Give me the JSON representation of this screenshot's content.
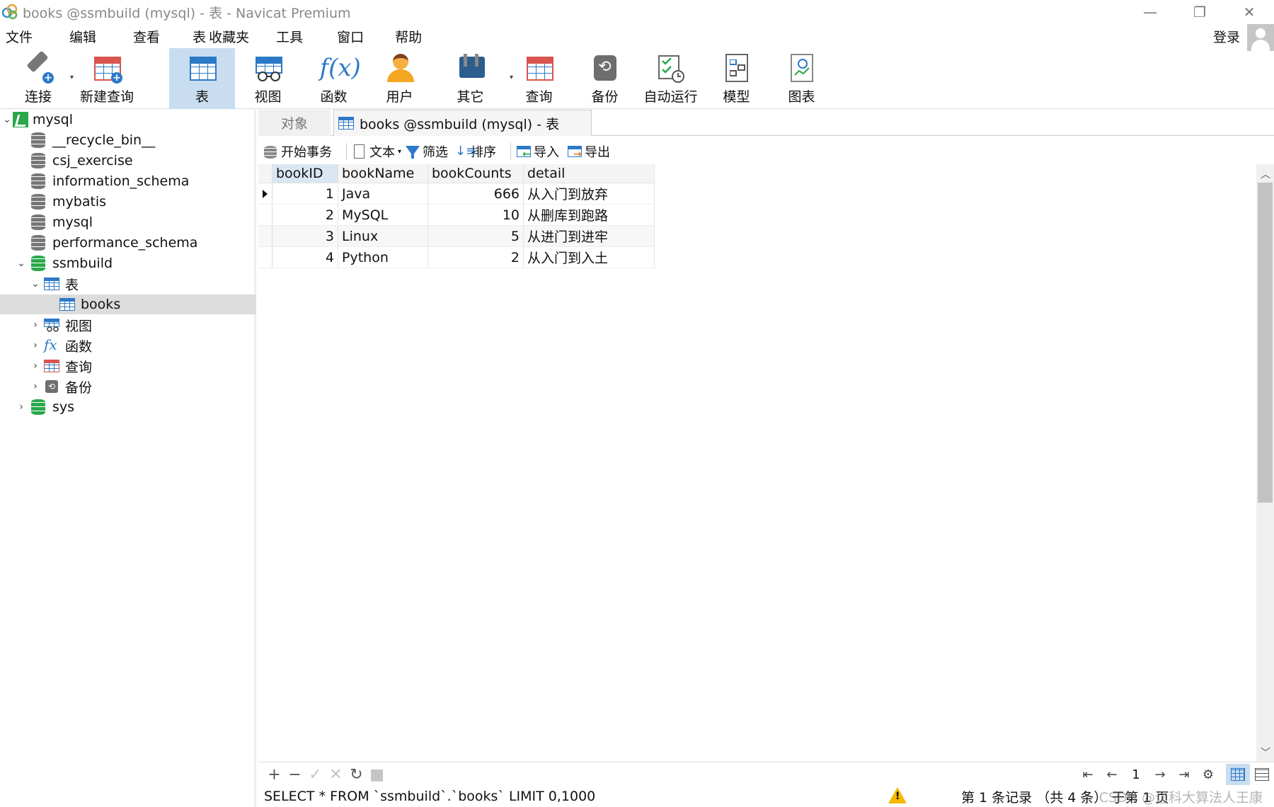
{
  "window": {
    "title": "books @ssmbuild (mysql) - 表 - Navicat Premium",
    "controls": [
      "—",
      "❐",
      "✕"
    ]
  },
  "menu": {
    "items": [
      "文件",
      "编辑",
      "查看",
      "表",
      "收藏夹",
      "工具",
      "窗口",
      "帮助"
    ],
    "login": "登录"
  },
  "toolbar": {
    "buttons": [
      {
        "label": "连接",
        "icon": "connection-icon"
      },
      {
        "label": "新建查询",
        "icon": "new-query-icon"
      },
      {
        "label": "表",
        "icon": "table-icon",
        "active": true
      },
      {
        "label": "视图",
        "icon": "view-icon"
      },
      {
        "label": "函数",
        "icon": "function-icon"
      },
      {
        "label": "用户",
        "icon": "user-icon"
      },
      {
        "label": "其它",
        "icon": "tools-icon"
      },
      {
        "label": "查询",
        "icon": "query-icon"
      },
      {
        "label": "备份",
        "icon": "backup-icon"
      },
      {
        "label": "自动运行",
        "icon": "automation-icon"
      },
      {
        "label": "模型",
        "icon": "model-icon"
      },
      {
        "label": "图表",
        "icon": "chart-icon"
      }
    ]
  },
  "tree": {
    "connection": "mysql",
    "databases": [
      "__recycle_bin__",
      "csj_exercise",
      "information_schema",
      "mybatis",
      "mysql",
      "performance_schema",
      "ssmbuild",
      "sys"
    ],
    "ssmbuild_children": {
      "tables_label": "表",
      "tables": [
        "books"
      ],
      "views": "视图",
      "functions": "函数",
      "queries": "查询",
      "backups": "备份"
    }
  },
  "tabs": {
    "objects": "对象",
    "active": "books @ssmbuild (mysql) - 表"
  },
  "table_toolbar": {
    "begin_transaction": "开始事务",
    "text": "文本",
    "filter": "筛选",
    "sort": "排序",
    "import": "导入",
    "export": "导出"
  },
  "grid": {
    "columns": [
      "bookID",
      "bookName",
      "bookCounts",
      "detail"
    ],
    "rows": [
      {
        "bookID": "1",
        "bookName": "Java",
        "bookCounts": "666",
        "detail": "从入门到放弃"
      },
      {
        "bookID": "2",
        "bookName": "MySQL",
        "bookCounts": "10",
        "detail": "从删库到跑路"
      },
      {
        "bookID": "3",
        "bookName": "Linux",
        "bookCounts": "5",
        "detail": "从进门到进牢"
      },
      {
        "bookID": "4",
        "bookName": "Python",
        "bookCounts": "2",
        "detail": "从入门到入土"
      }
    ]
  },
  "pager": {
    "page": "1"
  },
  "status": {
    "sql": "SELECT * FROM `ssmbuild`.`books` LIMIT 0,1000",
    "records": "第 1 条记录 （共 4 条） 于第 1 页",
    "watermark": "CSDN @辽科大算法人王康"
  },
  "colors": {
    "accent": "#2c79c7",
    "active_bg": "#c8def0",
    "db_green": "#2aa84a"
  }
}
